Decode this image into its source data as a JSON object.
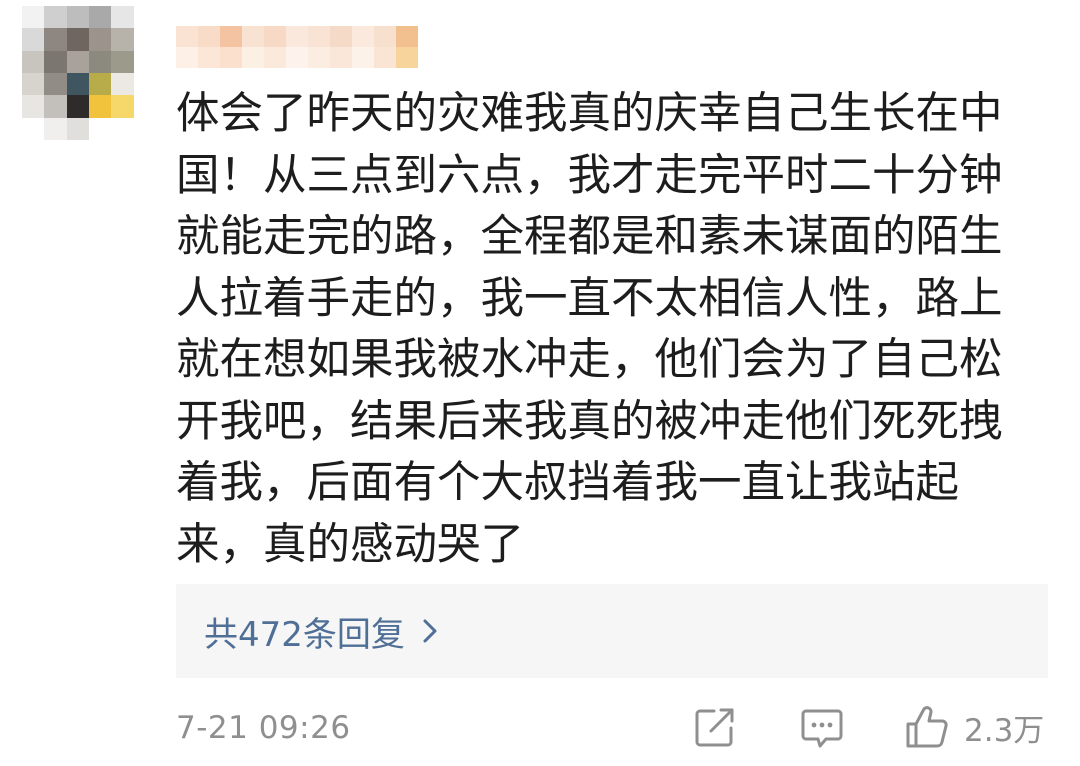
{
  "comment": {
    "body": "体会了昨天的灾难我真的庆幸自己生长在中国！从三点到六点，我才走完平时二十分钟就能走完的路，全程都是和素未谋面的陌生人拉着手走的，我一直不太相信人性，路上就在想如果我被水冲走，他们会为了自己松开我吧，结果后来我真的被冲走他们死死拽着我，后面有个大叔挡着我一直让我站起来，真的感动哭了",
    "replies_label": "共472条回复",
    "timestamp": "7-21 09:26",
    "like_count": "2.3万"
  },
  "icons": {
    "share": "share-icon",
    "comment": "comment-icon",
    "like": "thumbs-up-icon",
    "chevron": "chevron-right-icon"
  },
  "colors": {
    "link": "#4f6f96",
    "muted": "#8f8f8f",
    "reply_bg": "#f6f6f6",
    "text": "#1d1d1d"
  }
}
